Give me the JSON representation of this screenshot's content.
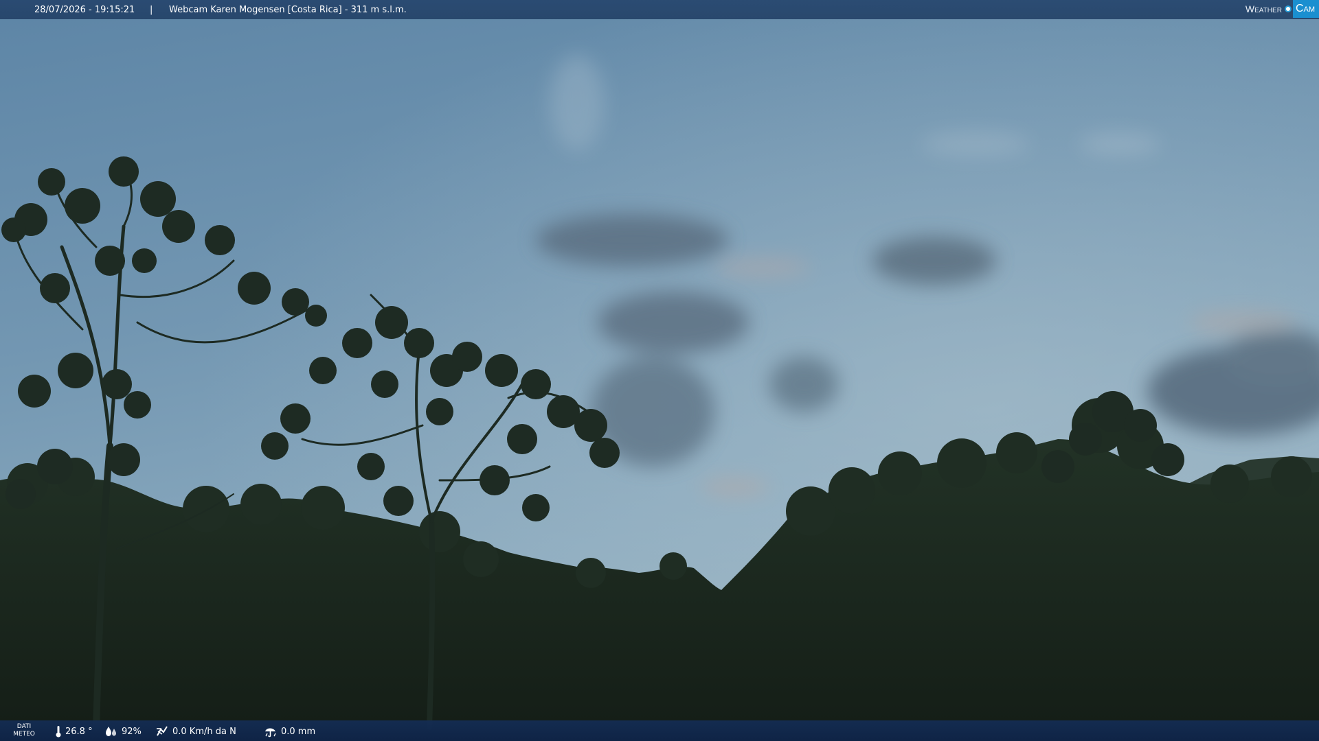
{
  "header": {
    "datetime": "28/07/2026 - 19:15:21",
    "separator": "|",
    "title": "Webcam Karen Mogensen [Costa Rica] - 311 m s.l.m."
  },
  "brand": {
    "left": "Weather",
    "right": "Cam",
    "accent": "#1a8fd0"
  },
  "weather": {
    "section_label_line1": "DATI",
    "section_label_line2": "METEO",
    "temperature": "26.8 °",
    "humidity": "92%",
    "wind": "0.0 Km/h da N",
    "rain": "0.0 mm",
    "icons": [
      "thermometer-icon",
      "humidity-icon",
      "wind-icon",
      "rain-icon"
    ]
  },
  "colors": {
    "sky_top": "#5f87a8",
    "sky_bottom": "#8aa8bd",
    "forest": "#1c2a20"
  }
}
